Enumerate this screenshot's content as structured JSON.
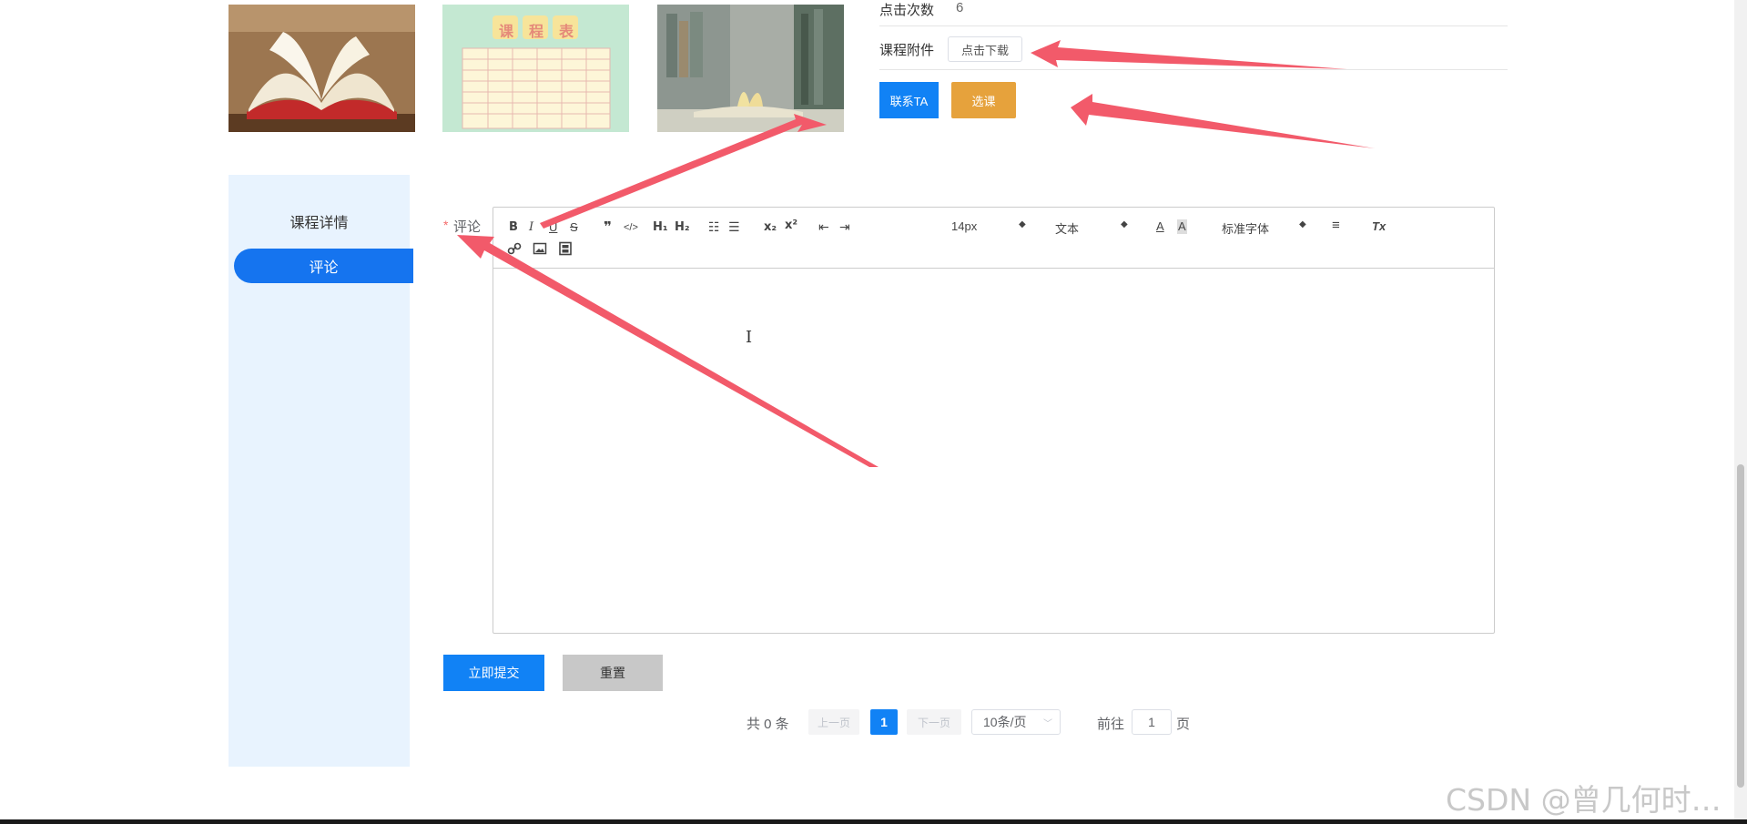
{
  "course_info": {
    "clicks_label": "点击次数",
    "clicks_value": "6",
    "attachment_label": "课程附件",
    "download_label": "点击下载",
    "contact_label": "联系TA",
    "select_label": "选课"
  },
  "thumbnails": {
    "schedule_title_chars": [
      "课",
      "程",
      "表"
    ]
  },
  "sidebar": {
    "items": [
      {
        "label": "课程详情"
      },
      {
        "label": "评论"
      }
    ]
  },
  "comment_form": {
    "label": "评论",
    "required_mark": "*",
    "toolbar": {
      "bold": "B",
      "italic": "I",
      "underline": "U",
      "strike": "S",
      "quote": "❞",
      "code": "</>",
      "h1": "H₁",
      "h2": "H₂",
      "ordered_list": "☷",
      "bullet_list": "☰",
      "subscript": "x₂",
      "superscript": "x²",
      "outdent": "⇤",
      "indent": "⇥",
      "size": "14px",
      "format": "文本",
      "font": "标准字体",
      "align": "≡",
      "clear": "Tx",
      "color": "A",
      "background": "A"
    },
    "submit_label": "立即提交",
    "reset_label": "重置"
  },
  "pagination": {
    "total": "共 0 条",
    "prev": "上一页",
    "current": "1",
    "next": "下一页",
    "page_size": "10条/页",
    "goto_prefix": "前往",
    "goto_value": "1",
    "goto_suffix": "页"
  },
  "watermark": "CSDN @曾几何时…",
  "colors": {
    "primary": "#1182f5",
    "warning": "#e6a23c",
    "sidebar_bg": "#e8f3fe",
    "arrow": "#f25a6a"
  }
}
